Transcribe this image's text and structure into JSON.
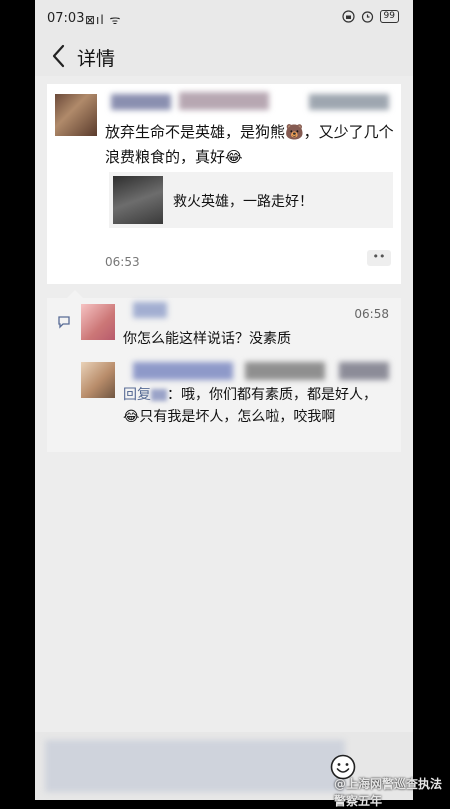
{
  "status_bar": {
    "time": "07:03",
    "left_icons": "⊠ıl ᯤ",
    "battery": "99"
  },
  "nav": {
    "title": "详情"
  },
  "post": {
    "text": "放弃生命不是英雄，是狗熊🐻，又少了几个浪费粮食的，真好😂",
    "link_title": "救火英雄，一路走好！",
    "time": "06:53",
    "more_label": "••"
  },
  "comments": [
    {
      "time": "06:58",
      "text": "你怎么能这样说话？没素质"
    },
    {
      "reply_prefix": "回复",
      "text_after": "：哦，你们都有素质，都是好人，😂只有我是坏人，怎么啦，咬我啊"
    }
  ],
  "watermark": "@上海网警巡查执法 警察五年"
}
